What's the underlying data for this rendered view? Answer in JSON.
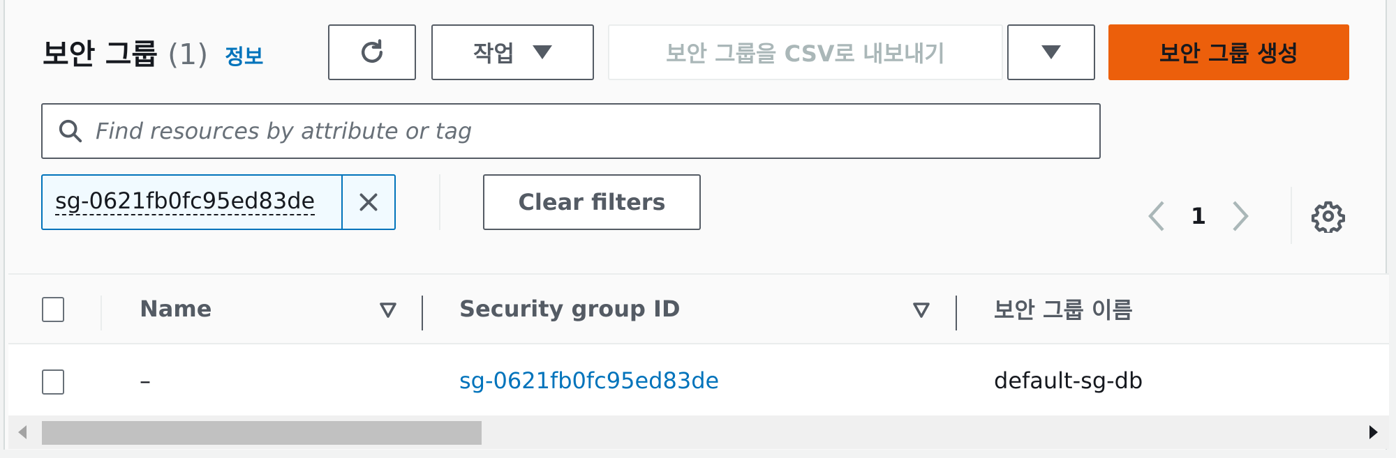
{
  "header": {
    "title": "보안 그룹",
    "count": "(1)",
    "info_link": "정보"
  },
  "toolbar": {
    "refresh_icon": "refresh-icon",
    "actions_label": "작업",
    "export_label": "보안 그룹을 CSV로 내보내기",
    "create_label": "보안 그룹 생성",
    "colors": {
      "primary": "#ec5f0b",
      "border": "#545b64",
      "link": "#0073bb"
    }
  },
  "search": {
    "placeholder": "Find resources by attribute or tag",
    "value": ""
  },
  "filters": {
    "tokens": [
      {
        "value": "sg-0621fb0fc95ed83de"
      }
    ],
    "clear_label": "Clear filters"
  },
  "pagination": {
    "current_page": "1"
  },
  "table": {
    "columns": [
      {
        "label": "Name",
        "sortable": true
      },
      {
        "label": "Security group ID",
        "sortable": true
      },
      {
        "label": "보안 그룹 이름",
        "sortable": false
      }
    ],
    "rows": [
      {
        "name": "–",
        "security_group_id": "sg-0621fb0fc95ed83de",
        "security_group_name": "default-sg-db",
        "selected": false
      }
    ]
  },
  "scrollbar": {
    "horizontal_position_fraction": 0.0,
    "visible_fraction": 0.33
  }
}
